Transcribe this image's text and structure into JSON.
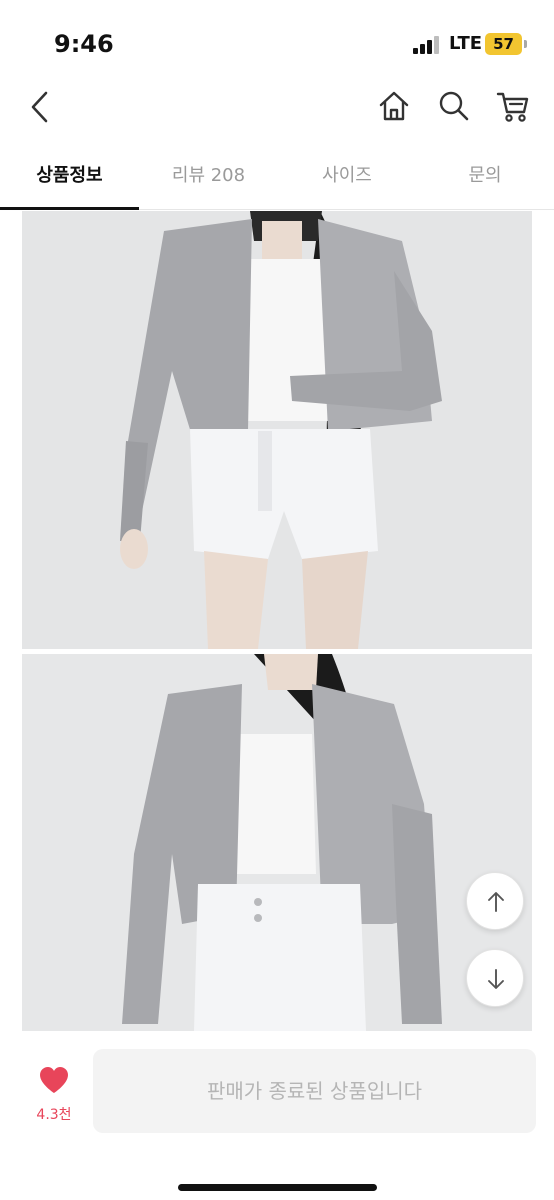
{
  "status_bar": {
    "time": "9:46",
    "network": "LTE",
    "battery": "57",
    "battery_color": "#f2c530"
  },
  "nav": {
    "back_icon": "chevron-left-icon",
    "home_icon": "home-icon",
    "search_icon": "search-icon",
    "cart_icon": "cart-icon"
  },
  "tabs": [
    {
      "label": "상품정보",
      "active": true
    },
    {
      "label": "리뷰 208",
      "active": false
    },
    {
      "label": "사이즈",
      "active": false
    },
    {
      "label": "문의",
      "active": false
    }
  ],
  "images": [
    {
      "name": "product-photo-1",
      "description_icon": "image"
    },
    {
      "name": "product-photo-2",
      "description_icon": "image"
    }
  ],
  "scroll_buttons": {
    "up_icon": "arrow-up-icon",
    "down_icon": "arrow-down-icon"
  },
  "bottom_bar": {
    "like_icon": "heart-icon",
    "like_count": "4.3천",
    "like_color": "#e8455a",
    "sold_out_label": "판매가 종료된 상품입니다"
  }
}
